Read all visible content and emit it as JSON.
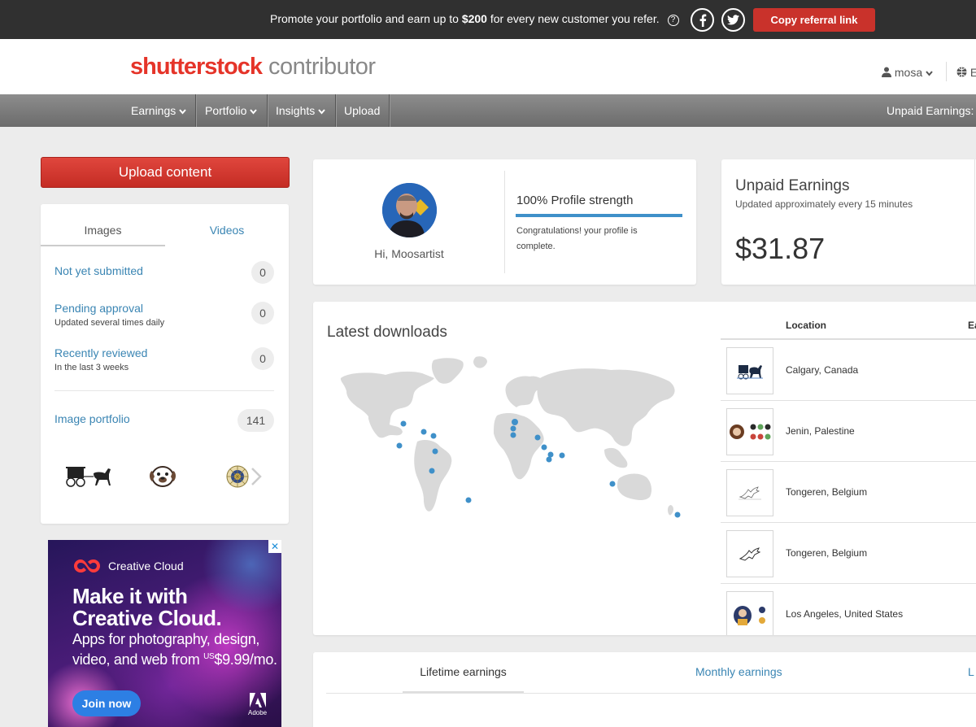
{
  "promo": {
    "text_before": "Promote your portfolio and earn up to ",
    "amount": "$200",
    "text_after": " for every new customer you refer.",
    "help_icon": "question-circle-icon",
    "copy_button": "Copy referral link",
    "social": [
      "facebook-icon",
      "twitter-icon"
    ]
  },
  "header": {
    "logo_main": "shutterstock",
    "logo_sub": "contributor",
    "user": "mosa",
    "language": "E"
  },
  "nav": {
    "items": [
      "Earnings",
      "Portfolio",
      "Insights",
      "Upload"
    ],
    "unpaid": "Unpaid Earnings: $"
  },
  "sidebar": {
    "upload_button": "Upload content",
    "tabs": [
      "Images",
      "Videos"
    ],
    "stats": [
      {
        "label": "Not yet submitted",
        "sub": "",
        "count": "0"
      },
      {
        "label": "Pending approval",
        "sub": "Updated several times daily",
        "count": "0"
      },
      {
        "label": "Recently reviewed",
        "sub": "In the last 3 weeks",
        "count": "0"
      },
      {
        "label": "Image portfolio",
        "sub": "",
        "count": "141"
      }
    ]
  },
  "ad": {
    "brand": "Creative Cloud",
    "headline_1": "Make it with",
    "headline_2": "Creative Cloud.",
    "body_1": "Apps for photography, design,",
    "body_2_prefix": "video, and web from ",
    "currency": "US",
    "price": "$9.99/mo.",
    "cta": "Join now",
    "sponsor": "Adobe"
  },
  "profile": {
    "greeting": "Hi, Moosartist",
    "strength_title": "100% Profile strength",
    "strength_percent": 100,
    "strength_message": "Congratulations! your profile is complete."
  },
  "unpaid": {
    "title": "Unpaid Earnings",
    "subtitle": "Updated approximately every 15 minutes",
    "amount": "$31.87"
  },
  "downloads": {
    "title": "Latest downloads",
    "headers": {
      "location": "Location",
      "earnings": "Ea"
    },
    "rows": [
      {
        "location": "Calgary, Canada"
      },
      {
        "location": "Jenin, Palestine"
      },
      {
        "location": "Tongeren, Belgium"
      },
      {
        "location": "Tongeren, Belgium"
      },
      {
        "location": "Los Angeles, United States"
      }
    ]
  },
  "earnings_tabs": [
    "Lifetime earnings",
    "Monthly earnings",
    "L"
  ],
  "colors": {
    "brand_red": "#e53429",
    "link_blue": "#3a85b3",
    "map_dot": "#3f90c9"
  }
}
